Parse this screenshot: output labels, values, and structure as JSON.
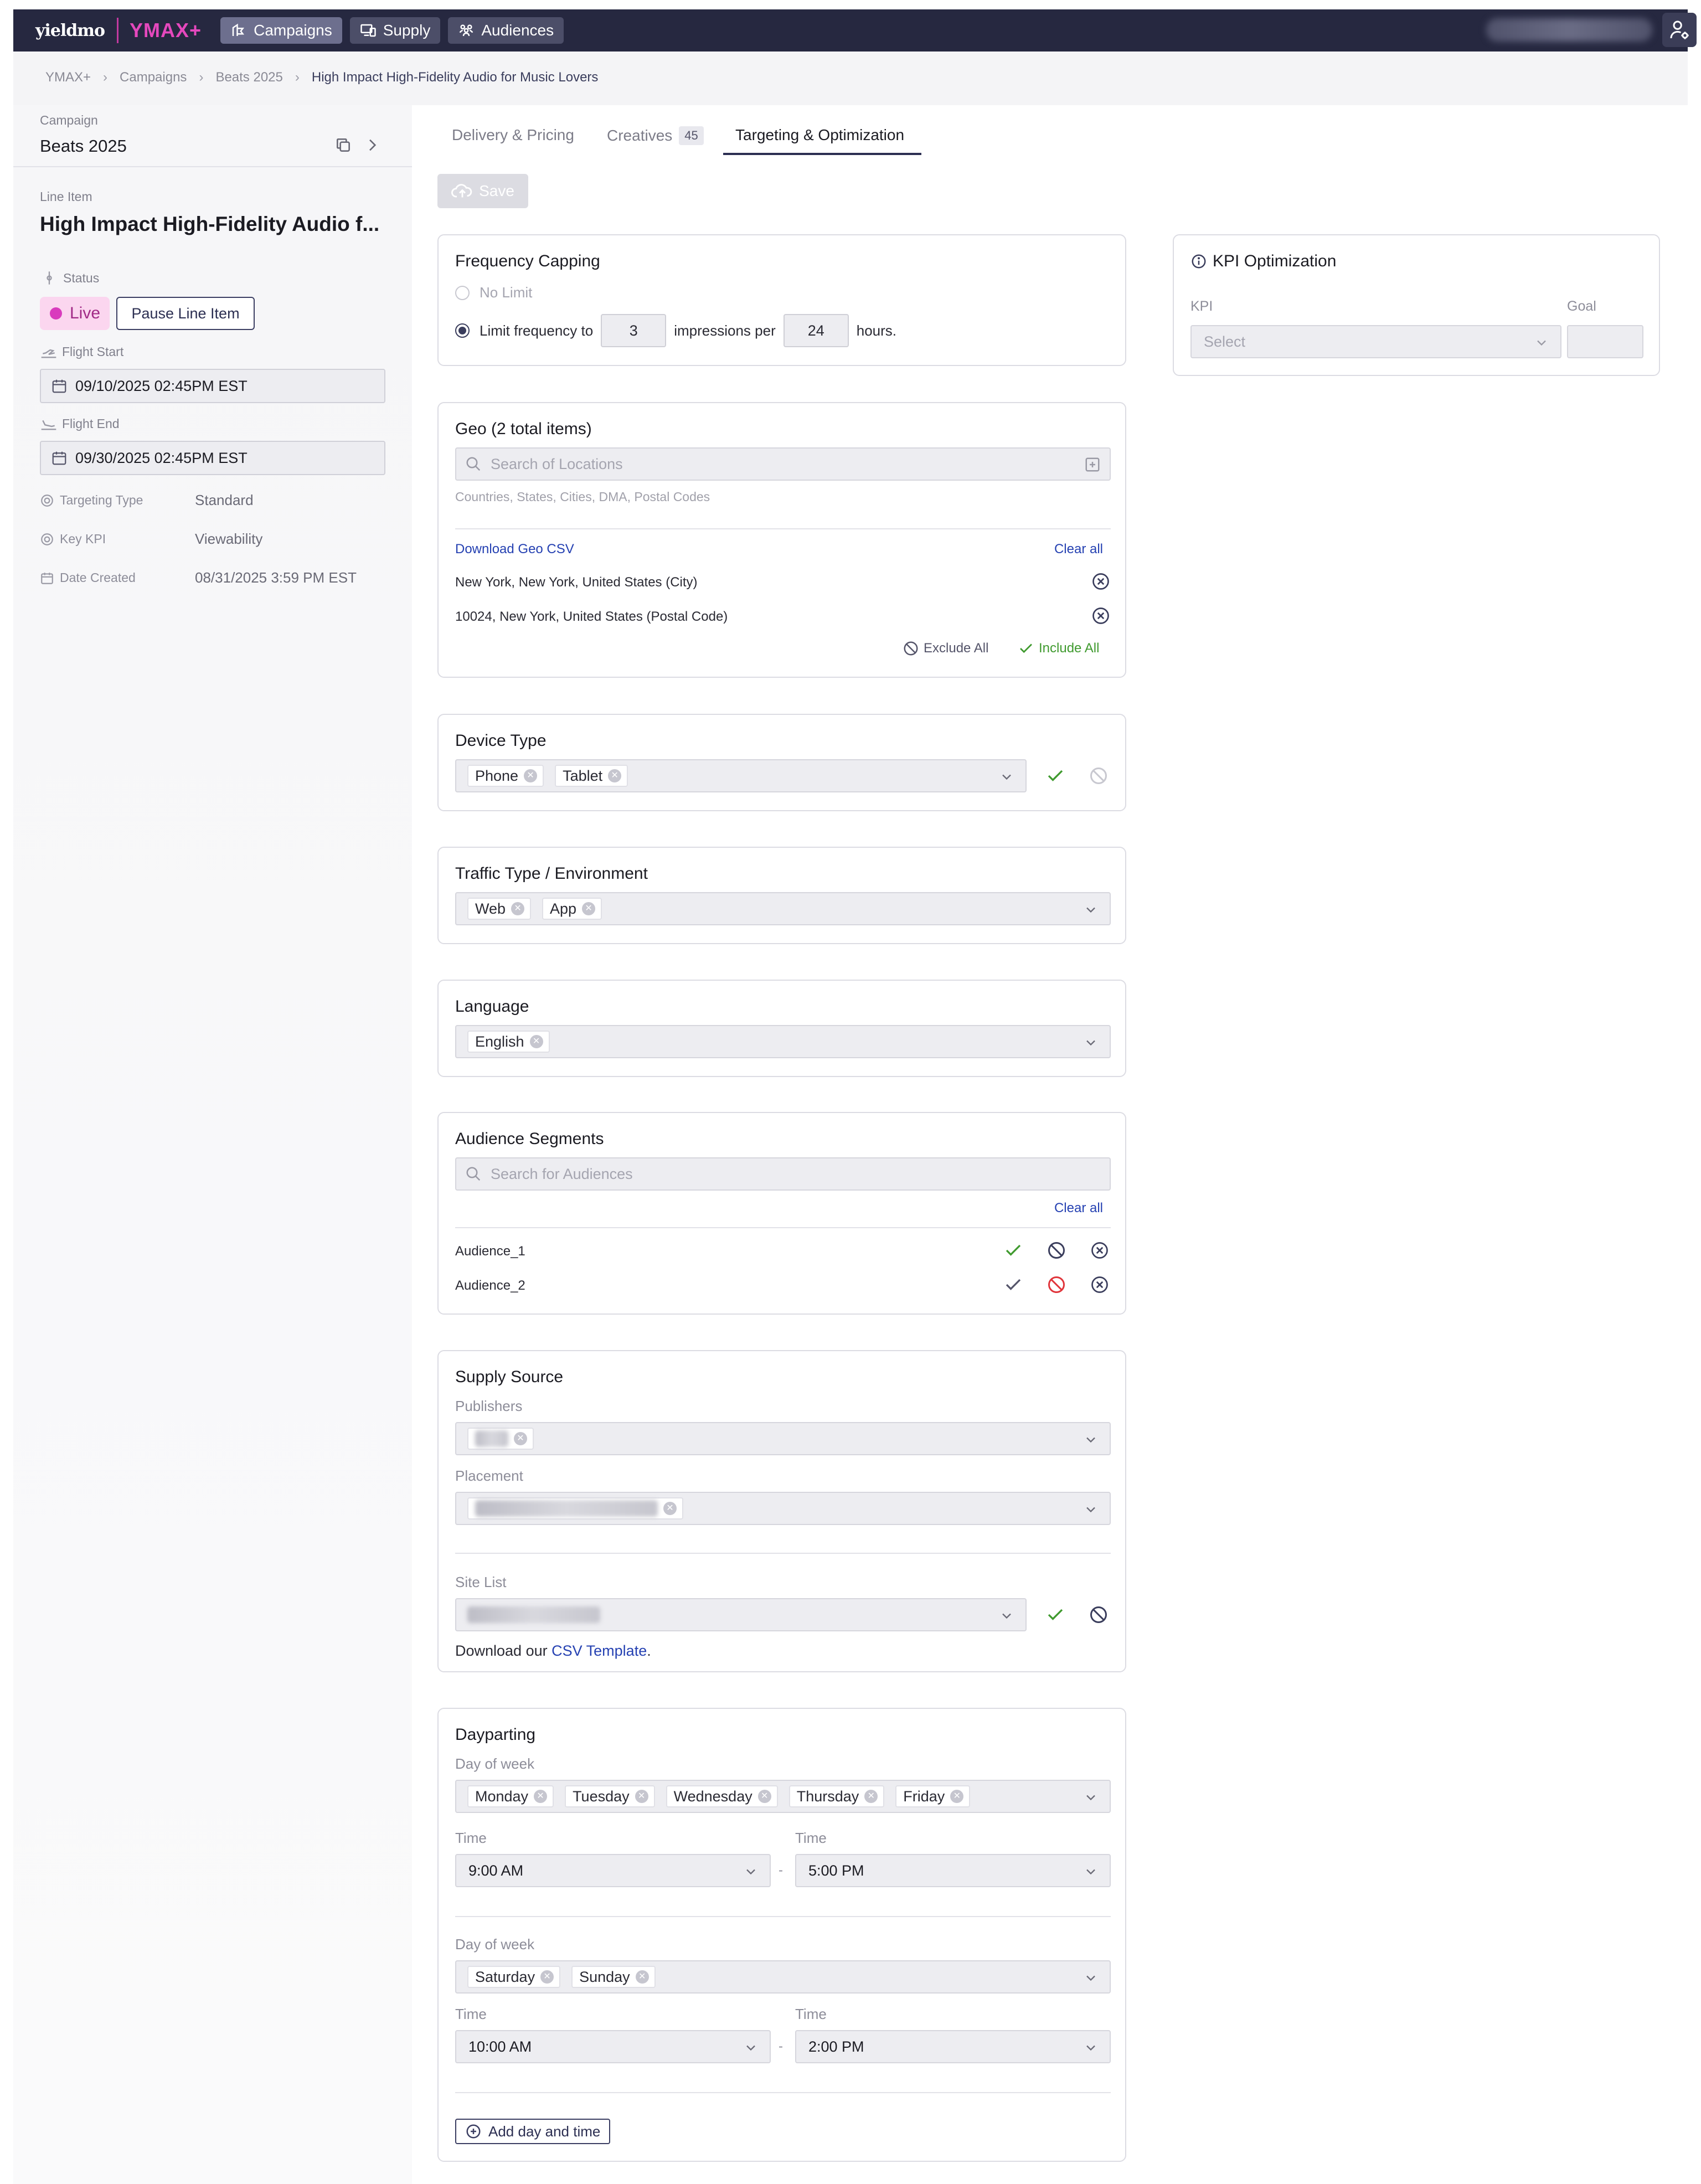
{
  "nav": {
    "brand": "yieldmo",
    "product": "YMAX+",
    "items": [
      {
        "label": "Campaigns"
      },
      {
        "label": "Supply"
      },
      {
        "label": "Audiences"
      }
    ]
  },
  "breadcrumb": [
    "YMAX+",
    "Campaigns",
    "Beats 2025",
    "High Impact High-Fidelity Audio for Music Lovers"
  ],
  "sidebar": {
    "campaign_label": "Campaign",
    "campaign_name": "Beats 2025",
    "line_item_label": "Line Item",
    "line_item_name": "High Impact High-Fidelity Audio f...",
    "status_label": "Status",
    "status_value": "Live",
    "pause_button": "Pause Line Item",
    "flight_start_label": "Flight Start",
    "flight_start": "09/10/2025 02:45PM EST",
    "flight_end_label": "Flight End",
    "flight_end": "09/30/2025 02:45PM EST",
    "targeting_type_label": "Targeting Type",
    "targeting_type": "Standard",
    "key_kpi_label": "Key KPI",
    "key_kpi": "Viewability",
    "date_created_label": "Date Created",
    "date_created": "08/31/2025 3:59 PM EST"
  },
  "tabs": {
    "delivery": "Delivery & Pricing",
    "creatives": "Creatives",
    "creatives_count": "45",
    "targeting": "Targeting & Optimization"
  },
  "save_label": "Save",
  "frequency": {
    "title": "Frequency Capping",
    "no_limit": "No Limit",
    "limit_prefix": "Limit frequency to",
    "impressions": "3",
    "mid_text": "impressions per",
    "hours": "24",
    "suffix": "hours."
  },
  "geo": {
    "title": "Geo (2 total items)",
    "placeholder": "Search of Locations",
    "hint": "Countries, States, Cities, DMA, Postal Codes",
    "download": "Download Geo CSV",
    "clear_all": "Clear all",
    "items": [
      "New York, New York, United States (City)",
      "10024, New York, United States (Postal Code)"
    ],
    "exclude_all": "Exclude All",
    "include_all": "Include All"
  },
  "device": {
    "title": "Device Type",
    "chips": [
      "Phone",
      "Tablet"
    ]
  },
  "traffic": {
    "title": "Traffic Type / Environment",
    "chips": [
      "Web",
      "App"
    ]
  },
  "language": {
    "title": "Language",
    "chips": [
      "English"
    ]
  },
  "audience": {
    "title": "Audience Segments",
    "placeholder": "Search for Audiences",
    "clear_all": "Clear all",
    "items": [
      "Audience_1",
      "Audience_2"
    ]
  },
  "supply": {
    "title": "Supply Source",
    "publishers_label": "Publishers",
    "placement_label": "Placement",
    "site_list_label": "Site List",
    "download_prefix": "Download our",
    "csv_link": "CSV Template",
    "download_suffix": "."
  },
  "dayparting": {
    "title": "Dayparting",
    "day_of_week_label": "Day of week",
    "time_label": "Time",
    "dash": "-",
    "groups": [
      {
        "days": [
          "Monday",
          "Tuesday",
          "Wednesday",
          "Thursday",
          "Friday"
        ],
        "start": "9:00 AM",
        "end": "5:00 PM"
      },
      {
        "days": [
          "Saturday",
          "Sunday"
        ],
        "start": "10:00 AM",
        "end": "2:00 PM"
      }
    ],
    "add_button": "Add day and time"
  },
  "kpi": {
    "title": "KPI Optimization",
    "kpi_label": "KPI",
    "goal_label": "Goal",
    "select_placeholder": "Select"
  },
  "colors": {
    "nav_bg": "#262840",
    "brand_accent": "#e548bd",
    "link": "#2541b2",
    "include_green": "#3f9a2e",
    "exclude_red": "#e0343a",
    "live_pink": "#d93bbd"
  },
  "icons": [
    "campaigns-icon",
    "supply-icon",
    "audiences-icon",
    "user-settings-icon",
    "copy-icon",
    "chevron-right-icon",
    "calendar-icon",
    "search-icon",
    "add-box-icon",
    "remove-circle-icon",
    "check-icon",
    "block-icon",
    "chevron-down-icon",
    "info-icon",
    "cloud-upload-icon",
    "plus-circle-icon"
  ]
}
